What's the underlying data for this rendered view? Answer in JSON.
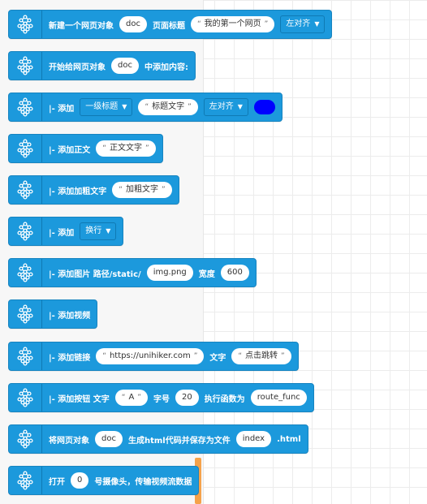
{
  "blocks": [
    {
      "parts": [
        {
          "kind": "label",
          "text": "新建一个网页对象"
        },
        {
          "kind": "pill",
          "text": "doc"
        },
        {
          "kind": "label",
          "text": "页面标题"
        },
        {
          "kind": "pill-q",
          "text": "我的第一个网页"
        },
        {
          "kind": "dropdown",
          "text": "左对齐"
        }
      ]
    },
    {
      "parts": [
        {
          "kind": "label",
          "text": "开始给网页对象"
        },
        {
          "kind": "pill",
          "text": "doc"
        },
        {
          "kind": "label",
          "text": "中添加内容:"
        }
      ]
    },
    {
      "parts": [
        {
          "kind": "label",
          "text": "|- 添加"
        },
        {
          "kind": "dropdown",
          "text": "一级标题"
        },
        {
          "kind": "pill-q",
          "text": "标题文字"
        },
        {
          "kind": "dropdown",
          "text": "左对齐"
        },
        {
          "kind": "color",
          "color": "#0000ff"
        }
      ]
    },
    {
      "parts": [
        {
          "kind": "label",
          "text": "|- 添加正文"
        },
        {
          "kind": "pill-q",
          "text": "正文文字"
        }
      ]
    },
    {
      "parts": [
        {
          "kind": "label",
          "text": "|- 添加加粗文字"
        },
        {
          "kind": "pill-q",
          "text": "加粗文字"
        }
      ]
    },
    {
      "parts": [
        {
          "kind": "label",
          "text": "|- 添加"
        },
        {
          "kind": "dropdown",
          "text": "换行"
        }
      ]
    },
    {
      "parts": [
        {
          "kind": "label",
          "text": "|- 添加图片 路径/static/"
        },
        {
          "kind": "pill",
          "text": "img.png"
        },
        {
          "kind": "label",
          "text": "宽度"
        },
        {
          "kind": "pill",
          "text": "600"
        }
      ]
    },
    {
      "parts": [
        {
          "kind": "label",
          "text": "|- 添加视频"
        }
      ]
    },
    {
      "parts": [
        {
          "kind": "label",
          "text": "|- 添加链接"
        },
        {
          "kind": "pill-q",
          "text": "https://unihiker.com"
        },
        {
          "kind": "label",
          "text": "文字"
        },
        {
          "kind": "pill-q",
          "text": "点击跳转"
        }
      ]
    },
    {
      "parts": [
        {
          "kind": "label",
          "text": "|- 添加按钮 文字"
        },
        {
          "kind": "pill-q",
          "text": "A"
        },
        {
          "kind": "label",
          "text": "字号"
        },
        {
          "kind": "pill",
          "text": "20"
        },
        {
          "kind": "label",
          "text": "执行函数为"
        },
        {
          "kind": "pill",
          "text": "route_func"
        }
      ]
    },
    {
      "parts": [
        {
          "kind": "label",
          "text": "将网页对象"
        },
        {
          "kind": "pill",
          "text": "doc"
        },
        {
          "kind": "label",
          "text": "生成html代码并保存为文件"
        },
        {
          "kind": "pill",
          "text": "index"
        },
        {
          "kind": "label",
          "text": ".html"
        }
      ]
    },
    {
      "parts": [
        {
          "kind": "label",
          "text": "打开"
        },
        {
          "kind": "pill",
          "text": "0"
        },
        {
          "kind": "label",
          "text": "号摄像头，传输视频流数据"
        }
      ]
    }
  ],
  "colors": {
    "block": "#1c99dc",
    "accent": "#f5a24a"
  },
  "icon": "unihiker-network-icon"
}
